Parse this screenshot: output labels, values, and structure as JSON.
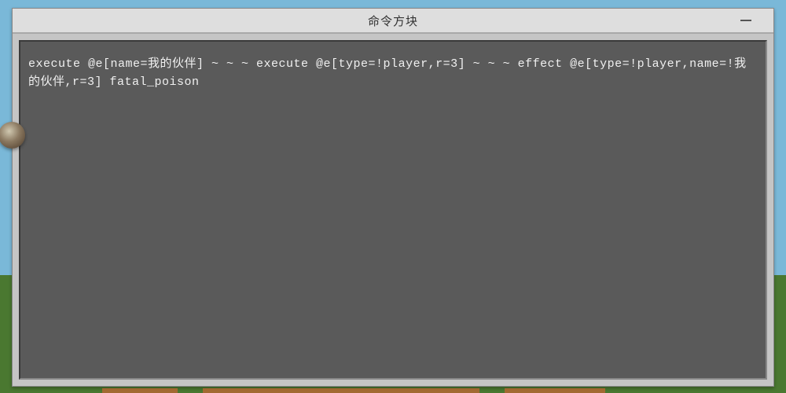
{
  "window": {
    "title": "命令方块"
  },
  "command": {
    "text": "execute @e[name=我的伙伴] ~ ~ ~ execute @e[type=!player,r=3] ~ ~ ~ effect @e[type=!player,name=!我的伙伴,r=3] fatal_poison"
  }
}
